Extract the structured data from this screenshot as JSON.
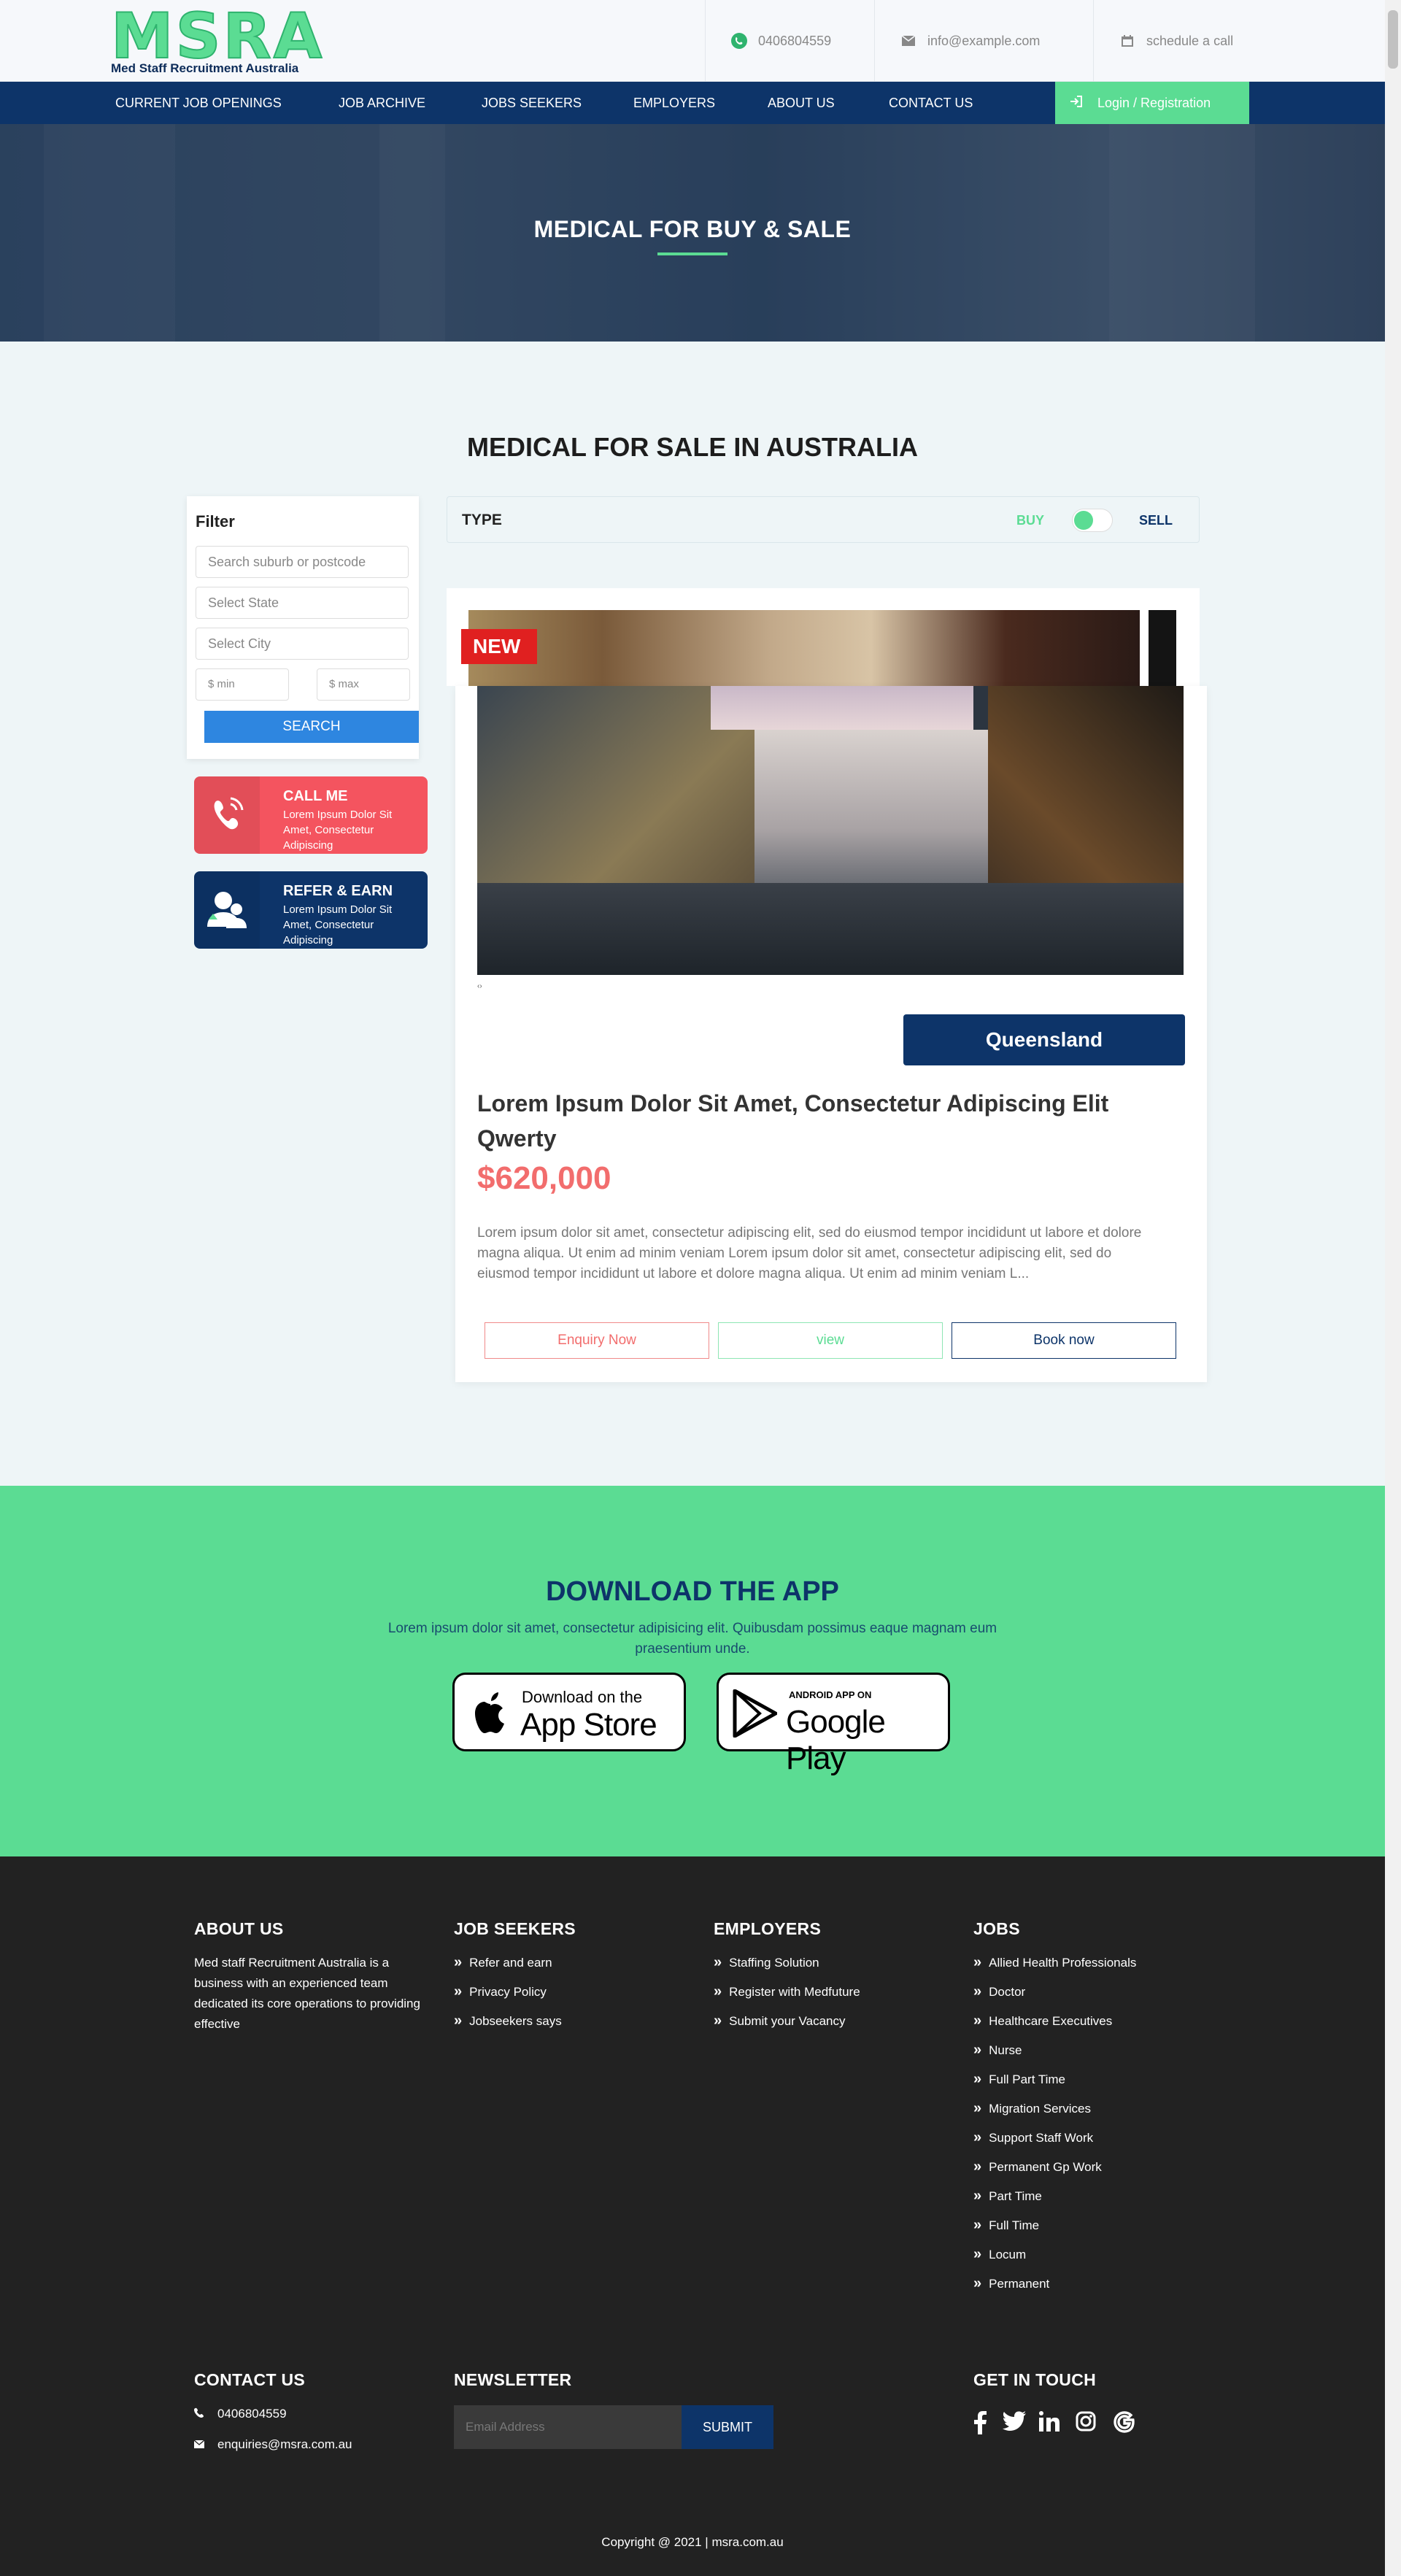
{
  "brand": {
    "mark": "MSRA",
    "name": "Med Staff Recruitment Australia",
    "accent": "#5bdc93",
    "navy": "#0d3469"
  },
  "topbar": {
    "phone": "0406804559",
    "email": "info@example.com",
    "schedule": "schedule a call"
  },
  "nav": {
    "items": [
      "CURRENT JOB OPENINGS",
      "JOB ARCHIVE",
      "JOBS SEEKERS",
      "EMPLOYERS",
      "ABOUT US",
      "CONTACT US"
    ],
    "login": "Login / Registration"
  },
  "hero": {
    "title": "MEDICAL FOR BUY & SALE"
  },
  "main": {
    "section_title": "MEDICAL FOR SALE IN AUSTRALIA"
  },
  "filter": {
    "title": "Filter",
    "suburb_placeholder": "Search suburb or postcode",
    "state_placeholder": "Select State",
    "city_placeholder": "Select City",
    "min_placeholder": "$ min",
    "max_placeholder": "$ max",
    "search_label": "SEARCH"
  },
  "promos": [
    {
      "title": "CALL ME",
      "text": "Lorem Ipsum Dolor Sit Amet, Consectetur Adipiscing",
      "color": "#f4545f"
    },
    {
      "title": "REFER & EARN",
      "text": "Lorem Ipsum Dolor Sit Amet, Consectetur Adipiscing",
      "color": "#0d3469"
    }
  ],
  "type": {
    "label": "TYPE",
    "buy": "BUY",
    "sell": "SELL",
    "selected": "BUY"
  },
  "listing": {
    "badge": "NEW",
    "caption": "‹›",
    "region": "Queensland",
    "title": "Lorem Ipsum Dolor Sit Amet, Consectetur Adipiscing Elit Qwerty",
    "price": "$620,000",
    "description": "Lorem ipsum dolor sit amet, consectetur adipiscing elit, sed do eiusmod tempor incididunt ut labore et dolore magna aliqua. Ut enim ad minim veniam Lorem ipsum dolor sit amet, consectetur adipiscing elit, sed do eiusmod tempor incididunt ut labore et dolore magna aliqua. Ut enim ad minim veniam L...",
    "enquiry": "Enquiry Now",
    "view": "view",
    "book": "Book now"
  },
  "app": {
    "title": "DOWNLOAD THE APP",
    "text": "Lorem ipsum dolor sit amet, consectetur adipisicing elit. Quibusdam possimus eaque magnam eum praesentium unde.",
    "appstore_small": "Download on the",
    "appstore_big": "App Store",
    "google_small": "ANDROID APP ON",
    "google_big": "Google Play"
  },
  "footer": {
    "about_title": "ABOUT US",
    "about_text": "Med staff Recruitment Australia is a business with an experienced team dedicated its core operations to providing effective",
    "seekers_title": "JOB SEEKERS",
    "seekers": [
      "Refer and earn",
      "Privacy Policy",
      "Jobseekers says"
    ],
    "employers_title": "EMPLOYERS",
    "employers": [
      "Staffing Solution",
      "Register with Medfuture",
      "Submit your Vacancy"
    ],
    "jobs_title": "JOBS",
    "jobs": [
      "Allied Health Professionals",
      "Doctor",
      "Healthcare Executives",
      "Nurse",
      "Full Part Time",
      "Migration Services",
      "Support Staff Work",
      "Permanent Gp Work",
      "Part Time",
      "Full Time",
      "Locum",
      "Permanent"
    ],
    "contact_title": "CONTACT US",
    "contact_phone": "0406804559",
    "contact_email": "enquiries@msra.com.au",
    "newsletter_title": "NEWSLETTER",
    "newsletter_placeholder": "Email Address",
    "newsletter_submit": "SUBMIT",
    "touch_title": "GET IN TOUCH",
    "social_icons": [
      "facebook-icon",
      "twitter-icon",
      "linkedin-icon",
      "instagram-icon",
      "google-icon"
    ],
    "copyright": "Copyright @ 2021 | msra.com.au"
  }
}
